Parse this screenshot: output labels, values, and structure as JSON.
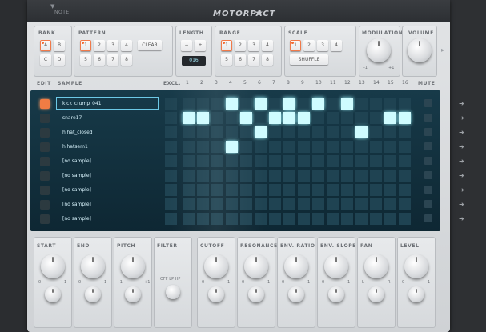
{
  "header": {
    "title": "MOTORPACT",
    "note_label": "NOTE"
  },
  "sections": {
    "bank": {
      "label": "BANK",
      "keys": [
        "A",
        "B",
        "C",
        "D"
      ]
    },
    "pattern": {
      "label": "PATTERN",
      "keys": [
        "1",
        "2",
        "3",
        "4",
        "5",
        "6",
        "7",
        "8"
      ],
      "clear_label": "CLEAR"
    },
    "length": {
      "label": "LENGTH",
      "minus": "−",
      "plus": "+",
      "value": "016"
    },
    "range": {
      "label": "RANGE",
      "keys": [
        "1",
        "2",
        "3",
        "4",
        "5",
        "6",
        "7",
        "8"
      ]
    },
    "scale": {
      "label": "SCALE",
      "keys": [
        "1",
        "2",
        "3",
        "4"
      ],
      "shuffle_label": "SHUFFLE"
    },
    "modulation": {
      "label": "MODULATION",
      "min": "-1",
      "max": "+1"
    },
    "volume": {
      "label": "VOLUME"
    }
  },
  "sequencer": {
    "edit_label": "EDIT",
    "sample_label": "SAMPLE",
    "excl_label": "EXCL.",
    "mute_label": "MUTE",
    "columns": [
      "1",
      "2",
      "3",
      "4",
      "5",
      "6",
      "7",
      "8",
      "9",
      "10",
      "11",
      "12",
      "13",
      "14",
      "15",
      "16"
    ],
    "tracks": [
      {
        "name": "kick_crump_041",
        "steps": [
          3,
          5,
          7,
          9,
          11
        ]
      },
      {
        "name": "snare17",
        "steps": [
          0,
          1,
          4,
          6,
          7,
          8,
          14,
          15
        ]
      },
      {
        "name": "hihat_closed",
        "steps": [
          5,
          12
        ]
      },
      {
        "name": "hihatsem1",
        "steps": [
          3
        ]
      },
      {
        "name": "[no sample]",
        "steps": []
      },
      {
        "name": "[no sample]",
        "steps": []
      },
      {
        "name": "[no sample]",
        "steps": []
      },
      {
        "name": "[no sample]",
        "steps": []
      },
      {
        "name": "[no sample]",
        "steps": []
      }
    ]
  },
  "bottom_controls": [
    {
      "label": "START",
      "min": "0",
      "max": "1"
    },
    {
      "label": "END",
      "min": "0",
      "max": "1"
    },
    {
      "label": "PITCH",
      "min": "-1",
      "max": "+1"
    },
    {
      "label": "FILTER",
      "options": "OFF LP HP"
    },
    {
      "label": "CUTOFF",
      "min": "0",
      "max": "1"
    },
    {
      "label": "RESONANCE",
      "min": "0",
      "max": "1"
    },
    {
      "label": "ENV. RATIO",
      "min": "0",
      "max": "1"
    },
    {
      "label": "ENV. SLOPE",
      "min": "0",
      "max": "1"
    },
    {
      "label": "PAN",
      "min": "L",
      "max": "R"
    },
    {
      "label": "LEVEL",
      "min": "0",
      "max": "1"
    }
  ],
  "colors": {
    "accent": "#f26a32",
    "step_on": "#cffcff",
    "lcd_text": "#9fe0f0"
  }
}
